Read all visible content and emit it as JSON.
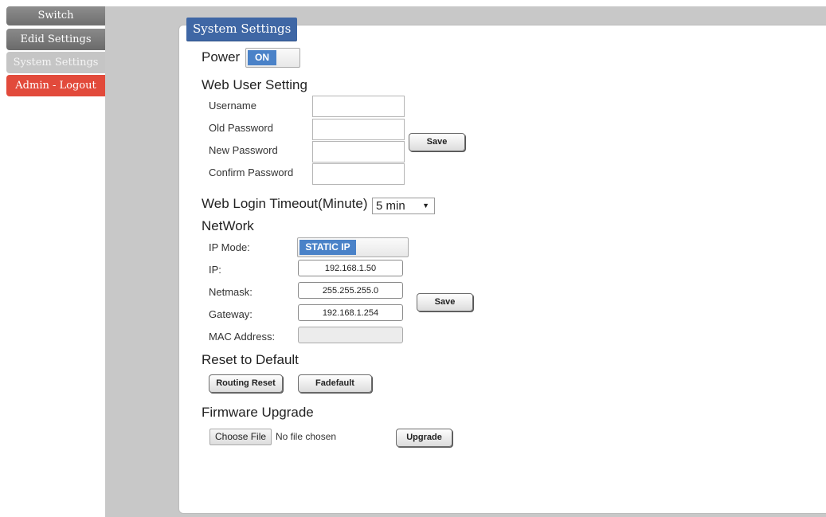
{
  "sidebar": {
    "items": [
      {
        "label": "Switch"
      },
      {
        "label": "Edid Settings"
      },
      {
        "label": "System Settings"
      },
      {
        "label": "Admin - Logout"
      }
    ]
  },
  "panel": {
    "title": "System Settings"
  },
  "power": {
    "label": "Power",
    "toggle": "ON"
  },
  "web_user": {
    "heading": "Web User Setting",
    "username_label": "Username",
    "old_password_label": "Old Password",
    "new_password_label": "New Password",
    "confirm_password_label": "Confirm Password",
    "save_label": "Save"
  },
  "timeout": {
    "label": "Web Login Timeout(Minute)",
    "value": "5 min"
  },
  "network": {
    "heading": "NetWork",
    "ip_mode_label": "IP Mode:",
    "ip_mode_value": "STATIC IP",
    "ip_label": "IP:",
    "ip_value": "192.168.1.50",
    "netmask_label": "Netmask:",
    "netmask_value": "255.255.255.0",
    "gateway_label": "Gateway:",
    "gateway_value": "192.168.1.254",
    "mac_label": "MAC Address:",
    "mac_value": "",
    "save_label": "Save"
  },
  "reset": {
    "heading": "Reset to Default",
    "routing_reset_label": "Routing Reset",
    "fadefault_label": "Fadefault"
  },
  "firmware": {
    "heading": "Firmware Upgrade",
    "choose_file_label": "Choose File",
    "no_file_text": "No file chosen",
    "upgrade_label": "Upgrade"
  },
  "colors": {
    "title_bg": "#3f67a5",
    "toggle_on": "#4a82c8",
    "logout_bg": "#e24a3b",
    "main_bg": "#c8c8c8"
  }
}
